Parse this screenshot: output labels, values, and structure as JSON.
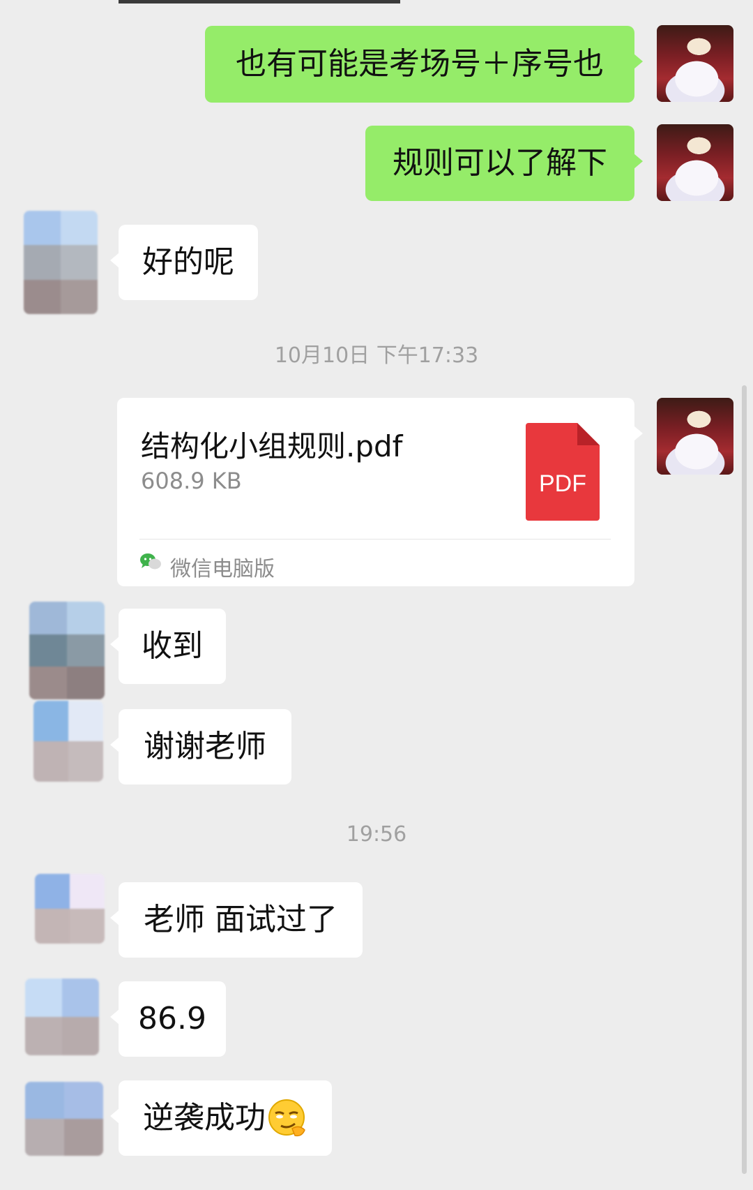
{
  "messages": {
    "m1": "也有可能是考场号＋序号也",
    "m2": "规则可以了解下",
    "m3": "好的呢",
    "m4": "收到",
    "m5": "谢谢老师",
    "m6": "老师 面试过了",
    "m7": "86.9",
    "m8": "逆袭成功"
  },
  "timestamps": {
    "t1": "10月10日 下午17:33",
    "t2": "19:56"
  },
  "file": {
    "name": "结构化小组规则.pdf",
    "size": "608.9 KB",
    "icon_label": "PDF",
    "source": "微信电脑版"
  },
  "colors": {
    "background": "#ededed",
    "my_bubble": "#95ec69",
    "other_bubble": "#ffffff",
    "pdf_red": "#e8383d",
    "timestamp": "#a0a0a0"
  },
  "icons": {
    "file_type": "pdf-icon",
    "source_app": "wechat-icon",
    "emoji": "smirk-emoji"
  }
}
